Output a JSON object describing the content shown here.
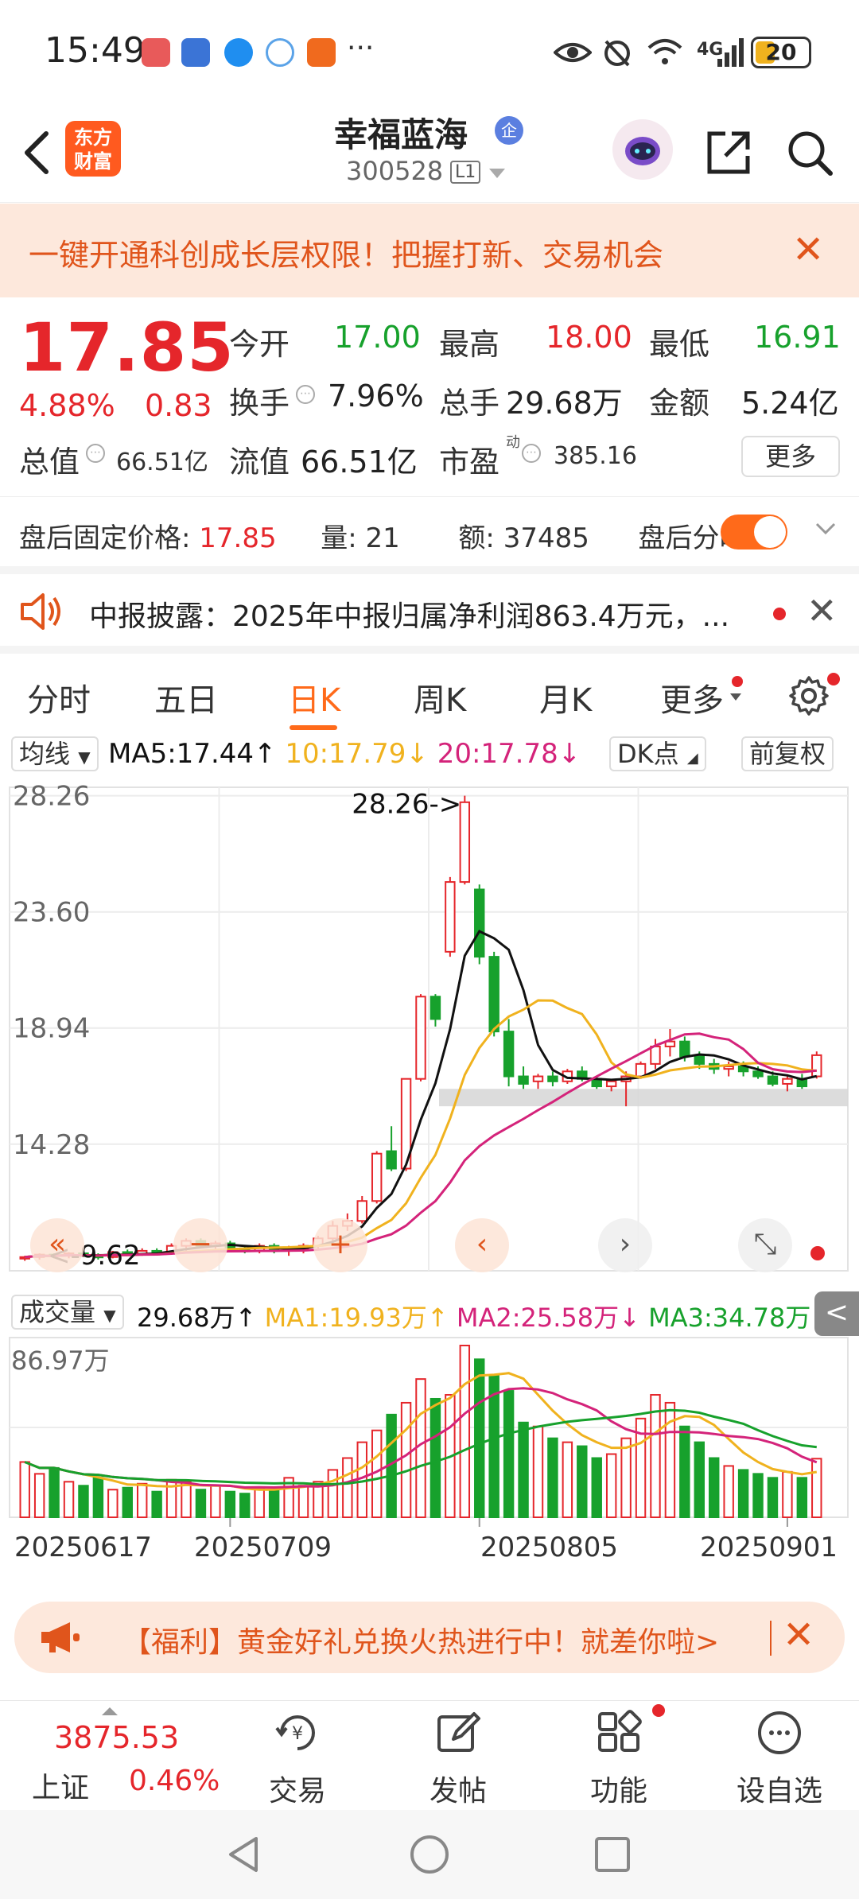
{
  "status_bar": {
    "time": "15:49",
    "network": "4G",
    "battery": "20",
    "more": "···"
  },
  "header": {
    "brand": "东方\n财富",
    "brand_line1": "东方",
    "brand_line2": "财富",
    "stock_name": "幸福蓝海",
    "badge": "企",
    "stock_code": "300528",
    "level": "L1"
  },
  "promo": {
    "text": "一键开通科创成长层权限！把握打新、交易机会",
    "close": "✕"
  },
  "quote": {
    "price": "17.85",
    "change_pct": "4.88%",
    "change_val": "0.83",
    "open_label": "今开",
    "open": "17.00",
    "high_label": "最高",
    "high": "18.00",
    "low_label": "最低",
    "low": "16.91",
    "turnover_label": "换手",
    "turnover": "7.96%",
    "volume_label": "总手",
    "volume": "29.68万",
    "amount_label": "金额",
    "amount": "5.24亿",
    "mktcap_label": "总值",
    "mktcap": "66.51亿",
    "float_label": "流值",
    "float_cap": "66.51亿",
    "pe_label": "市盈",
    "pe_sup": "动",
    "pe": "385.16",
    "more": "更多"
  },
  "after_hours": {
    "label": "盘后固定价格:",
    "price": "17.85",
    "vol_label": "量:",
    "vol": "21",
    "amt_label": "额:",
    "amt": "37485",
    "toggle_label": "盘后分时"
  },
  "news": {
    "text": "中报披露：2025年中报归属净利润863.4万元，..."
  },
  "tabs": [
    "分时",
    "五日",
    "日K",
    "周K",
    "月K",
    "更多"
  ],
  "chart_toolbar": {
    "ma_select": "均线",
    "ma5": "MA5:17.44↑",
    "ma10": "10:17.79↓",
    "ma20": "20:17.78↓",
    "dk": "DK点",
    "adjust": "前复权"
  },
  "volume_toolbar": {
    "select": "成交量",
    "vol": "29.68万↑",
    "ma1": "MA1:19.93万↑",
    "ma2": "MA2:25.58万↓",
    "ma3": "MA3:34.78万↓",
    "collapse": "<"
  },
  "chart_data": {
    "type": "candlestick",
    "y_ticks": [
      "28.26",
      "23.60",
      "18.94",
      "14.28"
    ],
    "max_label": "28.26->",
    "min_label": "<-9.62",
    "vol_max_label": "86.97万",
    "ylim": [
      9.2,
      28.6
    ],
    "x_dates": [
      "20250617",
      "20250709",
      "20250805",
      "20250901"
    ],
    "candles": [
      [
        9.7,
        9.8,
        9.6,
        9.75
      ],
      [
        9.75,
        9.9,
        9.65,
        9.85
      ],
      [
        9.85,
        9.9,
        9.7,
        9.8
      ],
      [
        9.8,
        9.95,
        9.7,
        9.9
      ],
      [
        9.9,
        10.0,
        9.75,
        9.8
      ],
      [
        9.8,
        9.9,
        9.65,
        9.75
      ],
      [
        9.75,
        10.0,
        9.7,
        9.95
      ],
      [
        9.95,
        10.05,
        9.8,
        9.85
      ],
      [
        9.85,
        10.1,
        9.8,
        10.0
      ],
      [
        10.0,
        10.1,
        9.85,
        9.9
      ],
      [
        9.9,
        10.3,
        9.85,
        10.2
      ],
      [
        10.2,
        10.5,
        10.0,
        10.4
      ],
      [
        10.4,
        10.5,
        10.1,
        10.2
      ],
      [
        10.2,
        10.4,
        10.0,
        10.3
      ],
      [
        10.3,
        10.4,
        10.0,
        10.1
      ],
      [
        10.1,
        10.2,
        9.9,
        10.0
      ],
      [
        10.0,
        10.3,
        9.9,
        10.2
      ],
      [
        10.2,
        10.3,
        9.9,
        10.0
      ],
      [
        10.0,
        10.2,
        9.8,
        10.1
      ],
      [
        10.1,
        10.3,
        9.9,
        10.2
      ],
      [
        10.2,
        10.6,
        10.1,
        10.5
      ],
      [
        10.5,
        11.2,
        10.4,
        11.0
      ],
      [
        11.0,
        11.5,
        10.8,
        11.2
      ],
      [
        11.2,
        12.2,
        11.1,
        12.0
      ],
      [
        12.0,
        14.0,
        11.9,
        13.9
      ],
      [
        14.0,
        15.0,
        13.2,
        13.3
      ],
      [
        13.3,
        16.9,
        13.2,
        16.9
      ],
      [
        16.9,
        20.3,
        16.8,
        20.2
      ],
      [
        20.2,
        20.3,
        19.0,
        19.3
      ],
      [
        22.0,
        25.0,
        21.8,
        24.8
      ],
      [
        24.8,
        28.26,
        24.7,
        28.0
      ],
      [
        24.5,
        24.7,
        21.5,
        21.8
      ],
      [
        21.8,
        22.0,
        18.6,
        18.8
      ],
      [
        18.8,
        19.3,
        16.6,
        17.0
      ],
      [
        17.0,
        17.4,
        16.5,
        16.7
      ],
      [
        16.8,
        17.1,
        16.5,
        17.0
      ],
      [
        17.0,
        17.2,
        16.6,
        16.8
      ],
      [
        16.8,
        17.3,
        16.7,
        17.2
      ],
      [
        17.2,
        17.4,
        16.8,
        16.9
      ],
      [
        16.9,
        17.0,
        16.5,
        16.6
      ],
      [
        16.6,
        16.9,
        16.4,
        16.8
      ],
      [
        16.8,
        17.2,
        15.8,
        17.0
      ],
      [
        17.0,
        17.6,
        16.9,
        17.5
      ],
      [
        17.5,
        18.5,
        17.3,
        18.2
      ],
      [
        18.2,
        18.9,
        17.8,
        18.4
      ],
      [
        18.4,
        18.6,
        17.6,
        17.8
      ],
      [
        17.8,
        18.0,
        17.3,
        17.5
      ],
      [
        17.5,
        17.7,
        17.1,
        17.3
      ],
      [
        17.3,
        17.6,
        17.0,
        17.4
      ],
      [
        17.4,
        17.6,
        17.0,
        17.2
      ],
      [
        17.2,
        17.4,
        16.9,
        17.0
      ],
      [
        17.0,
        17.2,
        16.6,
        16.7
      ],
      [
        16.7,
        17.0,
        16.4,
        16.9
      ],
      [
        16.9,
        17.1,
        16.5,
        16.6
      ],
      [
        17.0,
        18.0,
        16.91,
        17.85
      ]
    ],
    "volumes": [
      28,
      22,
      25,
      18,
      16,
      20,
      14,
      15,
      17,
      13,
      19,
      18,
      14,
      16,
      13,
      12,
      15,
      14,
      20,
      16,
      18,
      24,
      30,
      38,
      44,
      52,
      58,
      70,
      60,
      62,
      86.97,
      80,
      72,
      64,
      48,
      46,
      40,
      38,
      36,
      30,
      32,
      40,
      50,
      62,
      58,
      46,
      38,
      30,
      26,
      24,
      22,
      20,
      23,
      20,
      29.68
    ],
    "series": [
      {
        "name": "MA5",
        "color": "#111111"
      },
      {
        "name": "MA10",
        "color": "#f0b21e"
      },
      {
        "name": "MA20",
        "color": "#d4237a"
      }
    ],
    "vol_series": [
      {
        "name": "MA1",
        "color": "#f0b21e"
      },
      {
        "name": "MA2",
        "color": "#d4237a"
      },
      {
        "name": "MA3",
        "color": "#17a12c"
      }
    ],
    "up_color": "#e5262b",
    "down_color": "#17a12c"
  },
  "promo2": {
    "text": "【福利】黄金好礼兑换火热进行中！就差你啦>",
    "close": "✕"
  },
  "bottom_nav": {
    "index_value": "3875.53",
    "index_name": "上证",
    "index_pct": "0.46%",
    "items": [
      "交易",
      "发帖",
      "功能",
      "设自选"
    ]
  }
}
